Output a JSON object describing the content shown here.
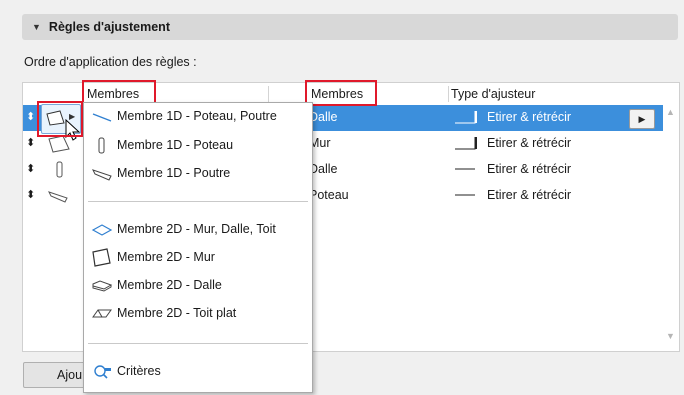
{
  "section": {
    "title": "Règles d'ajustement"
  },
  "order_label": "Ordre d'application des règles :",
  "columns": {
    "members_1": "Membres",
    "members_2": "Membres",
    "adjuster_type": "Type d'ajusteur"
  },
  "rows": [
    {
      "member_2": "Dalle",
      "adjuster": "Etirer & rétrécir",
      "selected": true
    },
    {
      "member_2": "Mur",
      "adjuster": "Etirer & rétrécir"
    },
    {
      "member_2": "Dalle",
      "adjuster": "Etirer & rétrécir"
    },
    {
      "member_2": "Poteau",
      "adjuster": "Etirer & rétrécir"
    }
  ],
  "menu": {
    "items_1d": [
      {
        "label": "Membre 1D - Poteau, Poutre",
        "icon": "line-icon"
      },
      {
        "label": "Membre 1D - Poteau",
        "icon": "column-icon"
      },
      {
        "label": "Membre 1D - Poutre",
        "icon": "beam-icon"
      }
    ],
    "items_2d": [
      {
        "label": "Membre 2D - Mur, Dalle, Toit",
        "icon": "plane-icon"
      },
      {
        "label": "Membre 2D - Mur",
        "icon": "wall-icon"
      },
      {
        "label": "Membre 2D - Dalle",
        "icon": "slab-icon"
      },
      {
        "label": "Membre 2D - Toit plat",
        "icon": "flat-roof-icon"
      }
    ],
    "criteria": {
      "label": "Critères",
      "icon": "criteria-icon"
    }
  },
  "buttons": {
    "add_partial": "Ajou"
  },
  "colors": {
    "selected_row": "#3c8fdc",
    "highlight_box": "#e0192b",
    "menu_icon_stroke": "#2f7fd0"
  }
}
